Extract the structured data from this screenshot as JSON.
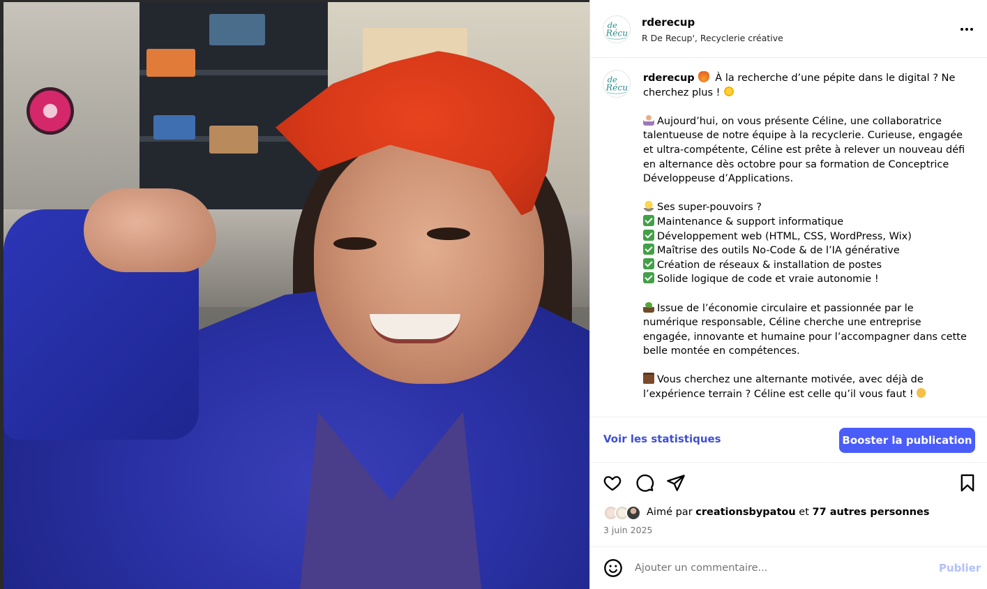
{
  "post": {
    "username": "rderecup",
    "subtitle": "R De Recup', Recyclerie créative",
    "avatar_logo_text": "de Récup"
  },
  "caption": {
    "username": "rderecup",
    "paragraphs": [
      [
        {
          "emoji": "fire-icon",
          "text": " À la recherche d’une pépite dans le digital ? Ne cherchez plus ! ",
          "trailing_emoji": "sun-icon"
        }
      ],
      [
        {
          "emoji": "person-icon",
          "text": "Aujourd’hui, on vous présente Céline, une collaboratrice talentueuse de notre équipe à la recyclerie. Curieuse, engagée et ultra-compétente, Céline est prête à relever un nouveau défi en alternance dès octobre pour sa formation de Conceptrice Développeuse d’Applications."
        }
      ],
      [
        {
          "emoji": "bulb-icon",
          "text": "Ses super-pouvoirs ?"
        },
        {
          "emoji": "check-icon",
          "text": "Maintenance & support informatique"
        },
        {
          "emoji": "check-icon",
          "text": "Développement web (HTML, CSS, WordPress, Wix)"
        },
        {
          "emoji": "check-icon",
          "text": "Maîtrise des outils No-Code & de l’IA générative"
        },
        {
          "emoji": "check-icon",
          "text": "Création de réseaux & installation de postes"
        },
        {
          "emoji": "check-icon",
          "text": "Solide logique de code et vraie autonomie !"
        }
      ],
      [
        {
          "emoji": "sprout-icon",
          "text": "Issue de l’économie circulaire et passionnée par le numérique responsable, Céline cherche une entreprise engagée, innovante et humaine pour l’accompagner dans cette belle montée en compétences."
        }
      ],
      [
        {
          "emoji": "briefcase-icon",
          "text": "Vous cherchez une alternante motivée, avec déjà de l’expérience terrain ? Céline est celle qu’il vous faut ! ",
          "trailing_emoji": "muscle-icon"
        }
      ]
    ]
  },
  "stats": {
    "link_label": "Voir les statistiques",
    "boost_label": "Booster la publication"
  },
  "likes": {
    "prefix": "Aimé par ",
    "user": "creationsbypatou",
    "middle": " et ",
    "others": "77 autres personnes"
  },
  "date": "3 juin 2025",
  "comment": {
    "placeholder": "Ajouter un commentaire...",
    "publish_label": "Publier"
  },
  "colors": {
    "accent": "#4a5df9",
    "link": "#3d4fd6",
    "publish_disabled": "#b2c0f8",
    "secondary_text": "#737373"
  }
}
